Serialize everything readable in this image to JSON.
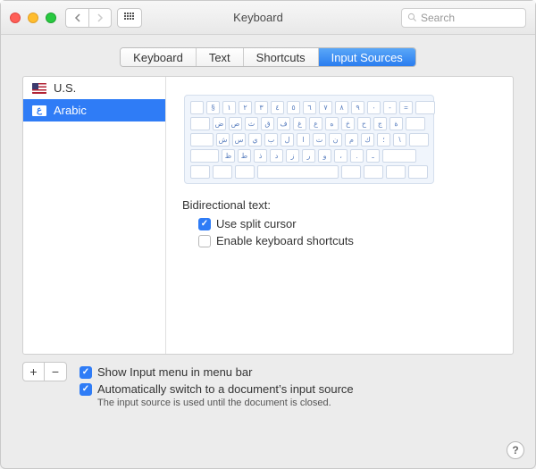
{
  "window": {
    "title": "Keyboard"
  },
  "search": {
    "placeholder": "Search"
  },
  "tabs": [
    {
      "label": "Keyboard"
    },
    {
      "label": "Text"
    },
    {
      "label": "Shortcuts"
    },
    {
      "label": "Input Sources",
      "active": true
    }
  ],
  "sources": [
    {
      "label": "U.S.",
      "flag": "us",
      "selected": false
    },
    {
      "label": "Arabic",
      "flag": "ar",
      "selected": true
    }
  ],
  "keyboard_rows": [
    [
      "§",
      "١",
      "٢",
      "٣",
      "٤",
      "٥",
      "٦",
      "٧",
      "٨",
      "٩",
      "٠",
      "-",
      "="
    ],
    [
      "ض",
      "ص",
      "ث",
      "ق",
      "ف",
      "غ",
      "ع",
      "ه",
      "خ",
      "ح",
      "ج",
      "ة"
    ],
    [
      "ش",
      "س",
      "ي",
      "ب",
      "ل",
      "ا",
      "ت",
      "ن",
      "م",
      "ك",
      "؛",
      "\\"
    ],
    [
      "ظ",
      "ط",
      "ذ",
      "د",
      "ز",
      "ر",
      "و",
      "،",
      ".",
      "ـ"
    ]
  ],
  "bidi": {
    "section_label": "Bidirectional text:",
    "split_cursor": {
      "label": "Use split cursor",
      "checked": true
    },
    "kb_shortcuts": {
      "label": "Enable keyboard shortcuts",
      "checked": false
    }
  },
  "footer": {
    "show_menu": {
      "label": "Show Input menu in menu bar",
      "checked": true
    },
    "auto_switch": {
      "label": "Automatically switch to a document’s input source",
      "checked": true
    },
    "hint": "The input source is used until the document is closed."
  }
}
